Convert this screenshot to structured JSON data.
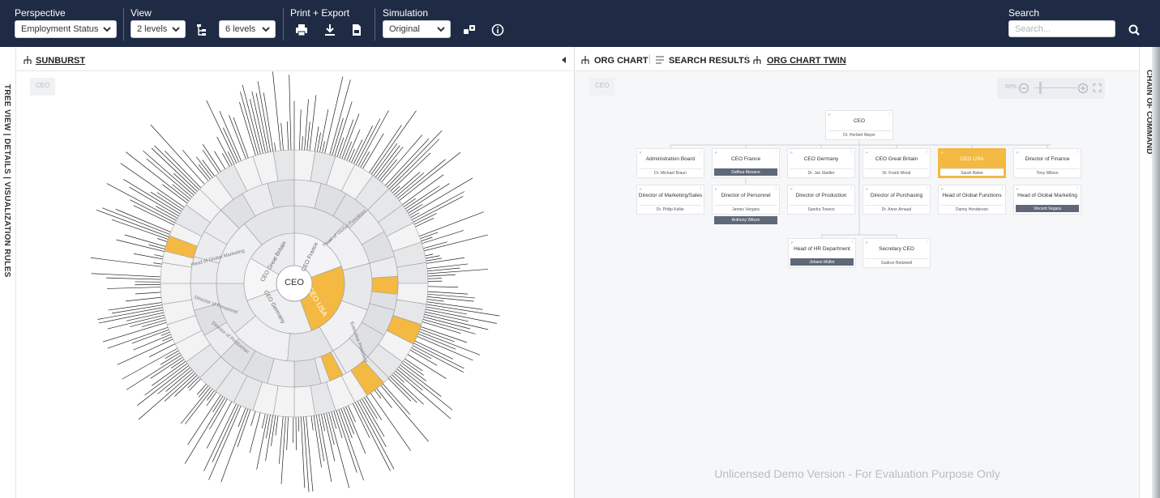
{
  "toolbar": {
    "perspective": {
      "label": "Perspective",
      "selected": "Employment Status"
    },
    "view": {
      "label": "View",
      "levels_up": "2 levels",
      "levels_down": "6 levels"
    },
    "print_export": {
      "label": "Print + Export"
    },
    "simulation": {
      "label": "Simulation",
      "selected": "Original"
    },
    "search": {
      "label": "Search",
      "placeholder": "Search..."
    }
  },
  "left_rail": {
    "label": "TREE VIEW | DETAILS | VISUALIZATION RULES"
  },
  "right_rail": {
    "label": "CHAIN OF COMMAND"
  },
  "left_pane": {
    "tab": "SUNBURST",
    "breadcrumb": "CEO",
    "sunburst": {
      "center": "CEO",
      "highlight_color": "#f4b942",
      "ring1_labels": [
        "CEO Great Britain",
        "CEO France",
        "CEO USA",
        "CEO Germany"
      ],
      "ring2_labels": [
        "Head of Global Functions",
        "Director of Production",
        "Head of Global Marketing",
        "Executive President",
        "Director of Personnel"
      ]
    }
  },
  "right_pane": {
    "tabs": [
      "ORG CHART",
      "SEARCH RESULTS",
      "ORG CHART TWIN"
    ],
    "breadcrumb": "CEO",
    "zoom": "50%",
    "root": {
      "title": "CEO",
      "person": "Dr. Herbert Mayer"
    },
    "row1": [
      {
        "title": "Administration Board",
        "person": "Dr. Michael Braun"
      },
      {
        "title": "CEO France",
        "person": "Daffour Alexane",
        "dark": true
      },
      {
        "title": "CEO Germany",
        "person": "Dr. Jan Stadler"
      },
      {
        "title": "CEO Great Britain",
        "person": "Dr. Frank Wood"
      },
      {
        "title": "CEO USA",
        "person": "Sarah Baker",
        "highlight": true
      },
      {
        "title": "Director of Finance",
        "person": "Tony Wilson"
      }
    ],
    "row2": [
      {
        "title": "Director of Marketing/Sales",
        "person": "Dr. Philip Keller"
      },
      {
        "title": "Director of Personnel",
        "person": "James Vergara",
        "extra": "Anthony Wilson"
      },
      {
        "title": "Director of Production",
        "person": "Sandra Towers"
      },
      {
        "title": "Director of Purchasing",
        "person": "Dr. Anne Arnaud"
      },
      {
        "title": "Head of Global Functions",
        "person": "Danny Henderson"
      },
      {
        "title": "Head of Global Marketing",
        "person": "Vincent Vegara",
        "dark": true
      }
    ],
    "row3": [
      {
        "title": "Head of HR Department",
        "person": "Johann Müller",
        "dark": true
      },
      {
        "title": "Secretary CEO",
        "person": "Gudrun Redzwell"
      }
    ],
    "watermark": "Unlicensed Demo Version - For Evaluation Purpose Only"
  }
}
